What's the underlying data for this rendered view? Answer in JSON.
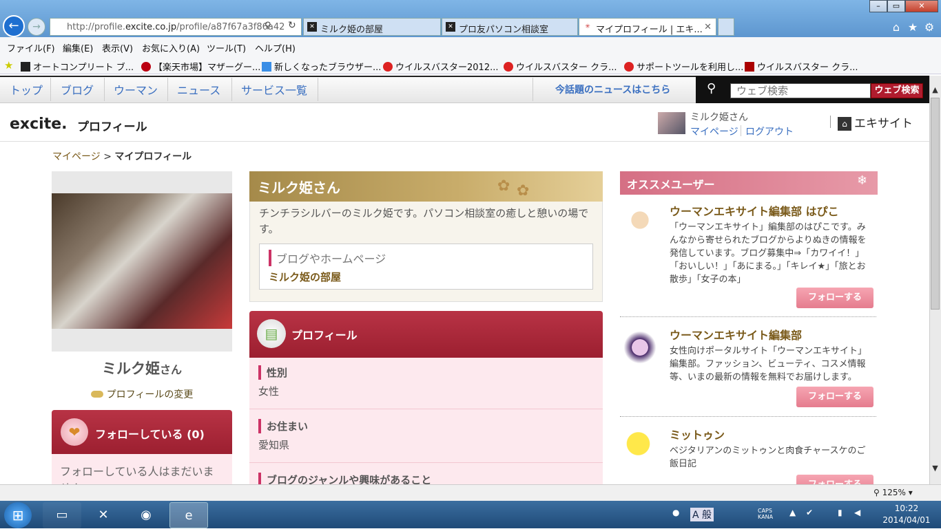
{
  "browser": {
    "url_prefix": "http://profile.",
    "url_host": "excite.co.jp",
    "url_path": "/profile/a87f67a3f86a42",
    "tabs": [
      {
        "label": "ミルク姫の部屋"
      },
      {
        "label": "プロ友パソコン相談室"
      },
      {
        "label": "マイプロフィール | エキ..."
      }
    ],
    "menu": [
      "ファイル(F)",
      "編集(E)",
      "表示(V)",
      "お気に入り(A)",
      "ツール(T)",
      "ヘルプ(H)"
    ],
    "favorites": [
      "オートコンプリート ブ...",
      "【楽天市場】マザーグー...",
      "新しくなったブラウザー...",
      "ウイルスバスター2012...",
      "ウイルスバスター クラ...",
      "サポートツールを利用し...",
      "ウイルスバスター クラ..."
    ],
    "zoom": "125%"
  },
  "site": {
    "nav": [
      "トップ",
      "ブログ",
      "ウーマン",
      "ニュース",
      "サービス一覧"
    ],
    "news_link": "今話題のニュースはこちら",
    "search_placeholder": "ウェブ検索",
    "search_button": "ウェブ検索",
    "logo": "excite.",
    "logo_sub": "プロフィール",
    "user_name": "ミルク姫さん",
    "mypage": "マイページ",
    "logout": "ログアウト",
    "excite_site": "エキサイト"
  },
  "breadcrumb": {
    "home": "マイページ",
    "sep": ">",
    "current": "マイプロフィール"
  },
  "profile": {
    "name": "ミルク姫",
    "name_suffix": "さん",
    "edit_label": "プロフィールの変更",
    "follow_label": "フォローしている (0)",
    "follow_empty": "フォローしている人はまだいません",
    "intro_title": "ミルク姫さん",
    "intro_text": "チンチラシルバーのミルク姫です。パソコン相談室の癒しと憩いの場です。",
    "blog_label": "ブログやホームページ",
    "blog_link": "ミルク姫の部屋",
    "section_title": "プロフィール",
    "fields": [
      {
        "key": "性別",
        "value": "女性"
      },
      {
        "key": "お住まい",
        "value": "愛知県"
      },
      {
        "key": "ブログのジャンルや興味があること",
        "value": ""
      }
    ]
  },
  "recommend": {
    "title": "オススメユーザー",
    "users": [
      {
        "name": "ウーマンエキサイト編集部 はぴこ",
        "desc": "「ウーマンエキサイト」編集部のはぴこです。みんなから寄せられたブログからよりぬきの情報を発信しています。ブログ募集中⇒「カワイイ！」「おいしい！」「あにまる。」「キレイ★」「旅とお散歩」「女子の本」",
        "button": "フォローする"
      },
      {
        "name": "ウーマンエキサイト編集部",
        "desc": "女性向けポータルサイト「ウーマンエキサイト」編集部。ファッション、ビューティ、コスメ情報等、いまの最新の情報を無料でお届けします。",
        "button": "フォローする"
      },
      {
        "name": "ミットゥン",
        "desc": "ベジタリアンのミットゥンと肉食チャースケのご飯日記",
        "button": "フォローする"
      }
    ]
  },
  "taskbar": {
    "time": "10:22",
    "date": "2014/04/01",
    "ime": "A 般"
  },
  "colors": {
    "accent": "#9c1f30",
    "link": "#3a6fc0",
    "gold": "#a58a4a",
    "pink": "#d56f84"
  }
}
